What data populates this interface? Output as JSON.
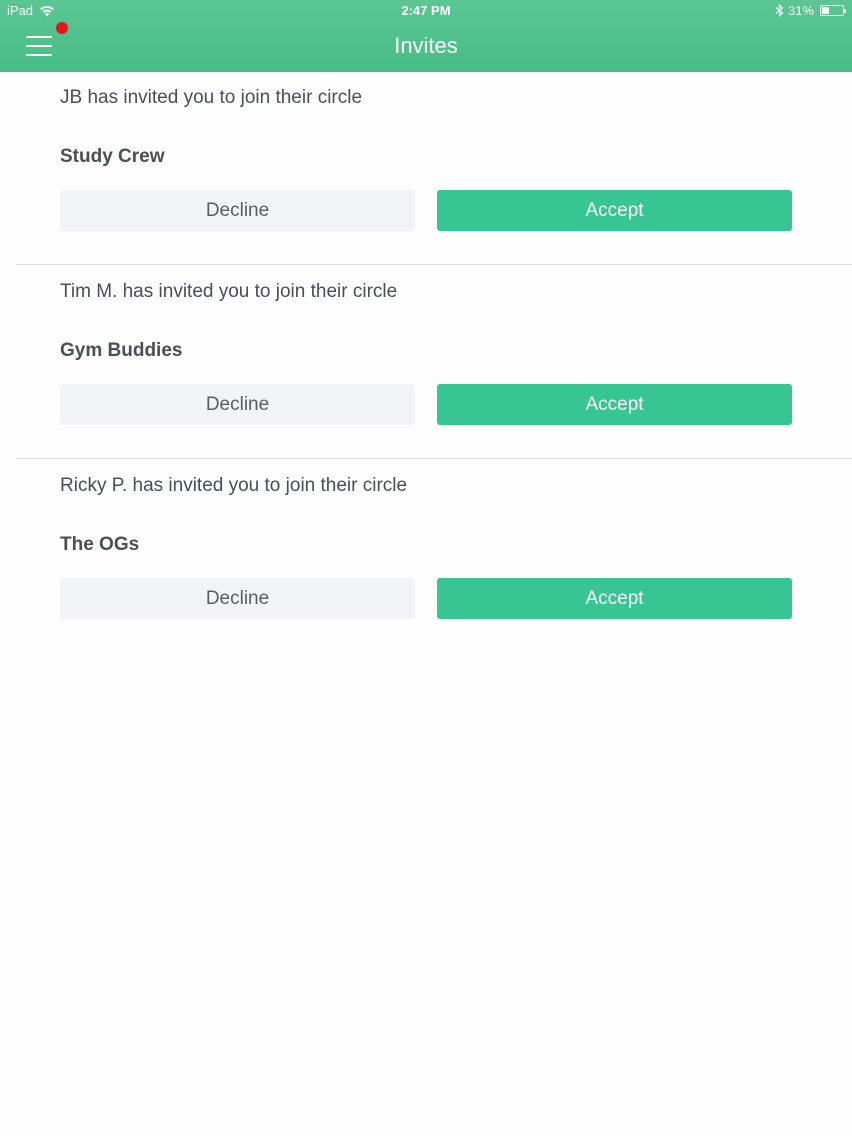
{
  "status_bar": {
    "device": "iPad",
    "time": "2:47 PM",
    "battery_text": "31%",
    "battery_level": 0.31
  },
  "header": {
    "title": "Invites",
    "menu_icon": "hamburger-menu-icon",
    "notification_color": "#e8141c"
  },
  "invites": [
    {
      "message": "JB has invited you to join their circle",
      "circle_name": "Study Crew",
      "decline_label": "Decline",
      "accept_label": "Accept"
    },
    {
      "message": "Tim M. has invited you to join their circle",
      "circle_name": "Gym Buddies",
      "decline_label": "Decline",
      "accept_label": "Accept"
    },
    {
      "message": "Ricky P. has invited you to join their circle",
      "circle_name": "The OGs",
      "decline_label": "Decline",
      "accept_label": "Accept"
    }
  ],
  "colors": {
    "header_green": "#4cc089",
    "accept_green": "#37c593",
    "decline_gray": "#f2f3f5"
  }
}
